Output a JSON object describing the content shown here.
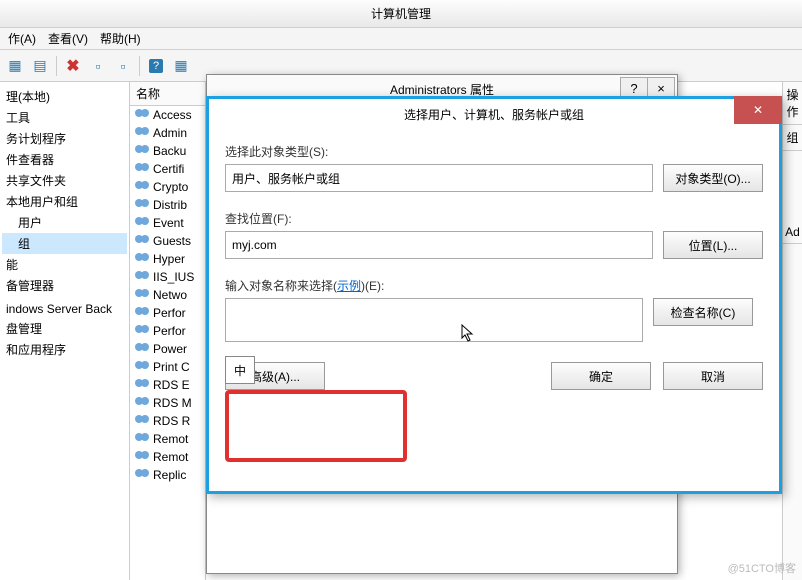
{
  "main_window": {
    "title": "计算机管理"
  },
  "menu": {
    "action": "作(A)",
    "view": "查看(V)",
    "help": "帮助(H)"
  },
  "tree": {
    "root": "理(本地)",
    "items": [
      "工具",
      "务计划程序",
      "件查看器",
      "共享文件夹",
      "本地用户和组",
      "用户",
      "组",
      "能",
      "备管理器",
      "",
      "indows Server Back",
      "盘管理",
      "和应用程序"
    ]
  },
  "list": {
    "header": "名称",
    "items": [
      "Access",
      "Admin",
      "Backu",
      "Certifi",
      "Crypto",
      "Distrib",
      "Event",
      "Guests",
      "Hyper",
      "IIS_IUS",
      "Netwo",
      "Perfor",
      "Perfor",
      "Power",
      "Print C",
      "RDS E",
      "RDS M",
      "RDS R",
      "Remot",
      "Remot",
      "Replic"
    ]
  },
  "dialog1": {
    "title": "Administrators 属性",
    "help": "?",
    "close": "×"
  },
  "dialog2": {
    "title": "选择用户、计算机、服务帐户或组",
    "close": "✕",
    "obj_type_label": "选择此对象类型(S):",
    "obj_type_value": "用户、服务帐户或组",
    "obj_type_btn": "对象类型(O)...",
    "location_label": "查找位置(F):",
    "location_value": "myj.com",
    "location_btn": "位置(L)...",
    "names_label_prefix": "输入对象名称来选择(",
    "names_label_link": "示例",
    "names_label_suffix": ")(E):",
    "names_value": "",
    "check_btn": "检查名称(C)",
    "advanced_btn": "高级(A)...",
    "ok_btn": "确定",
    "cancel_btn": "取消"
  },
  "ime": {
    "indicator": "中"
  },
  "right_col": {
    "actions": "操作",
    "group_short": "组",
    "ad_short": "Ad"
  },
  "watermark": "@51CTO博客"
}
